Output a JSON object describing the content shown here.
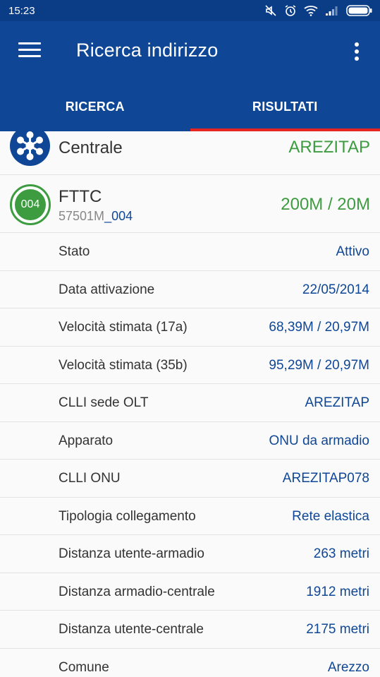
{
  "status_bar": {
    "time": "15:23",
    "icons": [
      "mute-icon",
      "alarm-icon",
      "wifi-icon",
      "signal-icon",
      "battery-icon"
    ]
  },
  "app_bar": {
    "title": "Ricerca indirizzo",
    "menu_icon": "hamburger-menu-icon",
    "more_icon": "more-vert-icon"
  },
  "tabs": [
    {
      "label": "RICERCA",
      "active": false
    },
    {
      "label": "RISULTATI",
      "active": true
    }
  ],
  "central": {
    "label": "Centrale",
    "value": "AREZITAP",
    "icon": "network-hub-icon"
  },
  "fttc": {
    "badge": "004",
    "label": "FTTC",
    "code_prefix": "57501M",
    "code_suffix": "_004",
    "value": "200M / 20M"
  },
  "details": [
    {
      "key": "Stato",
      "value": "Attivo"
    },
    {
      "key": "Data attivazione",
      "value": "22/05/2014"
    },
    {
      "key": "Velocità stimata (17a)",
      "value": "68,39M / 20,97M"
    },
    {
      "key": "Velocità stimata (35b)",
      "value": "95,29M / 20,97M"
    },
    {
      "key": "CLLI sede OLT",
      "value": "AREZITAP"
    },
    {
      "key": "Apparato",
      "value": "ONU da armadio"
    },
    {
      "key": "CLLI ONU",
      "value": "AREZITAP078"
    },
    {
      "key": "Tipologia collegamento",
      "value": "Rete elastica"
    },
    {
      "key": "Distanza utente-armadio",
      "value": "263 metri"
    },
    {
      "key": "Distanza armadio-centrale",
      "value": "1912 metri"
    },
    {
      "key": "Distanza utente-centrale",
      "value": "2175 metri"
    },
    {
      "key": "Comune",
      "value": "Arezzo"
    }
  ],
  "colors": {
    "primary": "#0f4796",
    "status_bar": "#0b3d86",
    "accent_green": "#3d9c40",
    "tab_indicator": "#e52521",
    "value_blue": "#0f4796"
  }
}
